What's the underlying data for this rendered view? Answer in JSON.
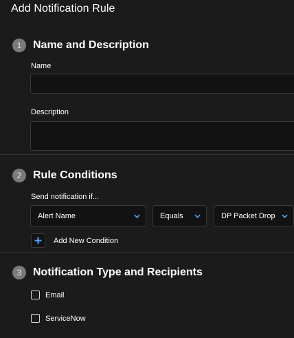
{
  "page": {
    "title": "Add Notification Rule"
  },
  "sections": [
    {
      "number": "1",
      "title": "Name and Description"
    },
    {
      "number": "2",
      "title": "Rule Conditions"
    },
    {
      "number": "3",
      "title": "Notification Type and Recipients"
    }
  ],
  "name_description": {
    "name_label": "Name",
    "name_value": "",
    "description_label": "Description",
    "description_value": ""
  },
  "rule_conditions": {
    "send_label": "Send notification if...",
    "condition": {
      "field": "Alert Name",
      "operator": "Equals",
      "value": "DP Packet Drop"
    },
    "add_condition_label": "Add New Condition"
  },
  "notification_types": [
    {
      "label": "Email",
      "checked": false
    },
    {
      "label": "ServiceNow",
      "checked": false
    }
  ],
  "colors": {
    "accent": "#4da3ff",
    "background": "#1b1b1b",
    "field_background": "#121212",
    "step_badge": "#7a7a7a"
  }
}
